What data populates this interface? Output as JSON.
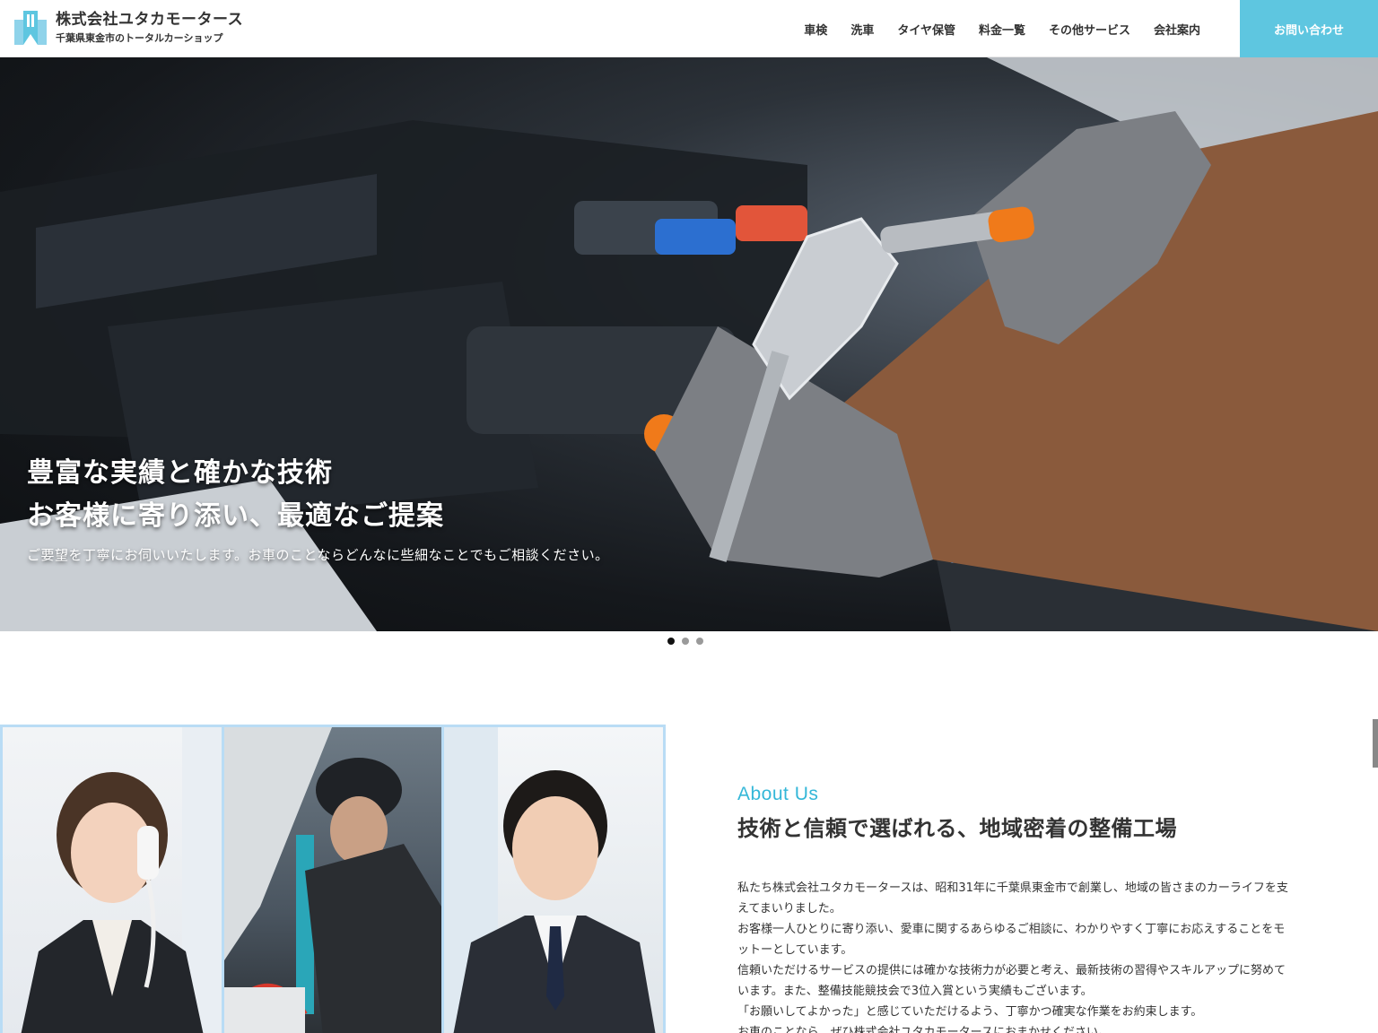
{
  "header": {
    "company_name": "株式会社ユタカモータース",
    "tagline": "千葉県東金市のトータルカーショップ",
    "nav": [
      {
        "label": "車検"
      },
      {
        "label": "洗車"
      },
      {
        "label": "タイヤ保管"
      },
      {
        "label": "料金一覧"
      },
      {
        "label": "その他サービス"
      },
      {
        "label": "会社案内"
      }
    ],
    "contact_label": "お問い合わせ"
  },
  "hero": {
    "line1": "豊富な実績と確かな技術",
    "line2": "お客様に寄り添い、最適なご提案",
    "subtext": "ご要望を丁寧にお伺いいたします。お車のことならどんなに些細なことでもご相談ください。",
    "slide_count": 3,
    "active_slide": 1
  },
  "about": {
    "label_en": "About Us",
    "title": "技術と信頼で選ばれる、地域密着の整備工場",
    "paragraphs": [
      "私たち株式会社ユタカモータースは、昭和31年に千葉県東金市で創業し、地域の皆さまのカーライフを支えてまいりました。",
      "お客様一人ひとりに寄り添い、愛車に関するあらゆるご相談に、わかりやすく丁寧にお応えすることをモットーとしています。",
      "信頼いただけるサービスの提供には確かな技術力が必要と考え、最新技術の習得やスキルアップに努めています。また、整備技能競技会で3位入賞という実績もございます。",
      "「お願いしてよかった」と感じていただけるよう、丁寧かつ確実な作業をお約束します。",
      "お車のことなら、ぜひ株式会社ユタカモータースにおまかせください。"
    ]
  },
  "colors": {
    "accent": "#5ec6e0",
    "about_label": "#34b7d8",
    "photo_border": "#b9dcf5"
  },
  "icons": {
    "logo": "building-logo-icon"
  }
}
